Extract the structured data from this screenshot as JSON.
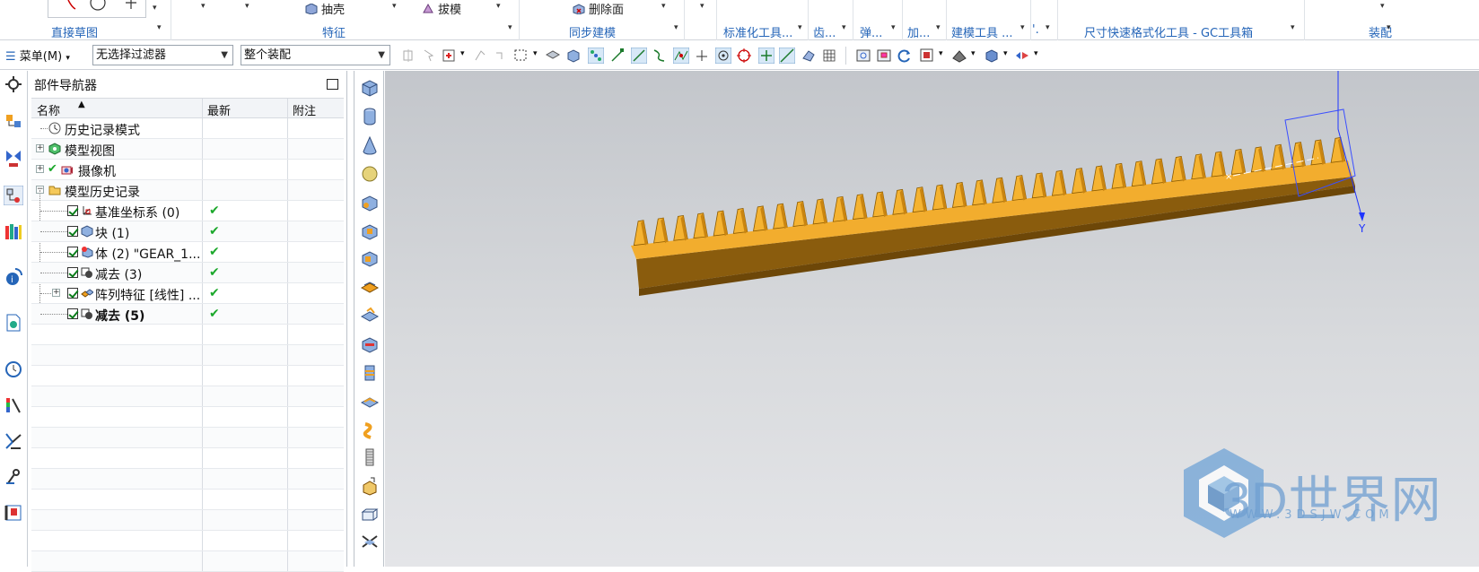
{
  "ribbon": {
    "groups": [
      "直接草图",
      "特征",
      "同步建模",
      "标准化工具...",
      "齿...",
      "弹...",
      "加...",
      "建模工具 ...",
      "尺寸快速格式化工具 - GC工具箱",
      "装配"
    ],
    "group_tail": "'.",
    "commands": {
      "shell": "抽壳",
      "draft": "拔模",
      "delete_face": "删除面"
    }
  },
  "toolbar": {
    "menu_label": "菜单(M)",
    "selection_filter": "无选择过滤器",
    "assembly_scope": "整个装配"
  },
  "navigator": {
    "title": "部件导航器",
    "columns": [
      "名称",
      "最新",
      "附注"
    ],
    "rows": [
      {
        "label": "历史记录模式",
        "icon": "clock-icon"
      },
      {
        "label": "模型视图",
        "icon": "model-view-icon"
      },
      {
        "label": "摄像机",
        "icon": "camera-icon"
      },
      {
        "label": "模型历史记录",
        "icon": "folder-icon"
      },
      {
        "label": "基准坐标系 (0)",
        "icon": "datum-csys-icon",
        "latest": "✔"
      },
      {
        "label": "块 (1)",
        "icon": "block-icon",
        "latest": "✔"
      },
      {
        "label": "体 (2) \"GEAR_1...",
        "icon": "body-icon",
        "latest": "✔"
      },
      {
        "label": "减去 (3)",
        "icon": "subtract-icon",
        "latest": "✔"
      },
      {
        "label": "阵列特征 [线性] ...",
        "icon": "pattern-icon",
        "latest": "✔"
      },
      {
        "label": "减去 (5)",
        "icon": "subtract-icon",
        "latest": "✔"
      }
    ]
  },
  "viewport": {
    "model": "gear rack",
    "axis_label": "Y",
    "watermark": "3D世界网",
    "watermark_url": "WWW.3DSJW.COM"
  },
  "colors": {
    "ribbon_label": "#2565b8",
    "rack": "#e8a21a",
    "viewport_top": "#c3c6cb",
    "check": "#1ba82b"
  }
}
